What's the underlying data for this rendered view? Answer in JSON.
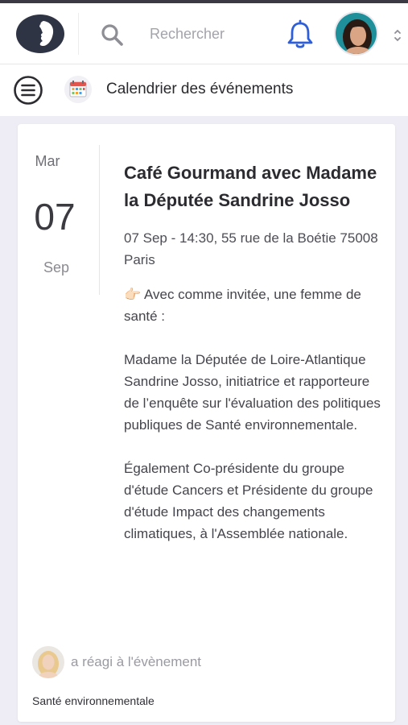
{
  "header": {
    "search_placeholder": "Rechercher"
  },
  "subbar": {
    "title": "Calendrier des événements"
  },
  "event": {
    "day_name": "Mar",
    "day_number": "07",
    "month": "Sep",
    "title": "Café Gourmand avec Madame la Députée Sandrine Josso",
    "meta": "07 Sep - 14:30,  55 rue de la Boétie 75008 Paris",
    "description": "👉🏻 Avec comme invitée, une femme de santé :\n\nMadame la Députée de Loire-Atlantique Sandrine Josso, initiatrice et rapporteure de l’enquête sur l'évaluation des politiques publiques de Santé environnementale.\n\nÉgalement Co-présidente du groupe d'étude Cancers et Présidente du groupe d'étude Impact des changements climatiques, à l'Assemblée nationale.",
    "reaction_text": "a réagi à l'évènement",
    "tag": "Santé environnementale"
  },
  "icons": {
    "logo": "woman-profile-logo",
    "search": "search-icon",
    "bell": "bell-icon",
    "menu": "menu-icon",
    "calendar": "calendar-icon",
    "chevron": "chevron-updown-icon"
  },
  "colors": {
    "accent": "#2f5fd6",
    "logo_dark": "#2f3445",
    "background": "#eeedf5"
  }
}
